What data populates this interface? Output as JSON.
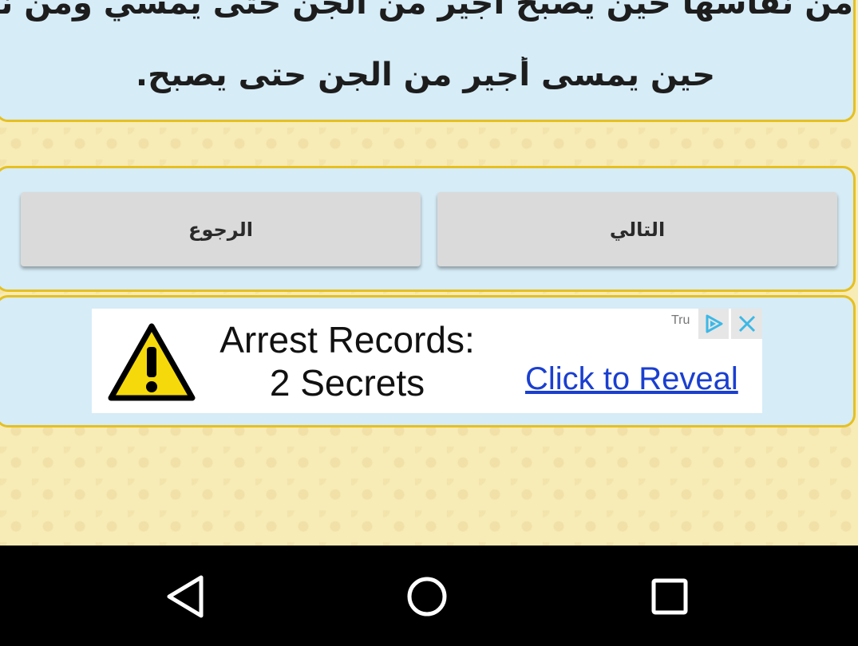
{
  "content": {
    "line1": "من نفاسها حين يصبح أجير من الجن حتى يمسي ومن نفاسها",
    "line2": "حين يمسى أجير من الجن حتى يصبح."
  },
  "buttons": {
    "next_label": "التالي",
    "back_label": "الرجوع"
  },
  "ad": {
    "headline_line1": "Arrest Records:",
    "headline_line2": "2 Secrets",
    "cta": "Click to Reveal",
    "advertiser": "Tru"
  },
  "colors": {
    "panel_bg": "#d6ecf7",
    "panel_border": "#e6c020",
    "page_bg": "#f7ebb6",
    "button_bg": "#dadada",
    "ad_link": "#1a3fd0",
    "adchoices": "#3db8e6",
    "navbar": "#000000"
  },
  "icons": {
    "warning": "warning-triangle-icon",
    "adchoices": "adchoices-icon",
    "close": "close-icon",
    "nav_back": "nav-back-icon",
    "nav_home": "nav-home-icon",
    "nav_recent": "nav-recent-icon"
  }
}
